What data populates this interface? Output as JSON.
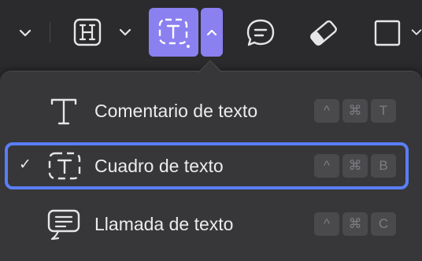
{
  "toolbar": {
    "items": [
      {
        "name": "chevron-down-icon"
      },
      {
        "name": "heading-icon"
      },
      {
        "name": "textbox-icon",
        "active": true
      },
      {
        "name": "comment-bubble-icon"
      },
      {
        "name": "eraser-icon"
      },
      {
        "name": "square-shape-icon"
      }
    ],
    "accent": "#8a80f0"
  },
  "menu": {
    "items": [
      {
        "label": "Comentario de texto",
        "icon": "text-comment-icon",
        "checked": false,
        "keys": [
          "^",
          "⌘",
          "T"
        ]
      },
      {
        "label": "Cuadro de texto",
        "icon": "text-box-icon",
        "checked": true,
        "keys": [
          "^",
          "⌘",
          "B"
        ]
      },
      {
        "label": "Llamada de texto",
        "icon": "text-callout-icon",
        "checked": false,
        "keys": [
          "^",
          "⌘",
          "C"
        ]
      }
    ],
    "check_glyph": "✓",
    "selection_color": "#5b7ef5"
  }
}
